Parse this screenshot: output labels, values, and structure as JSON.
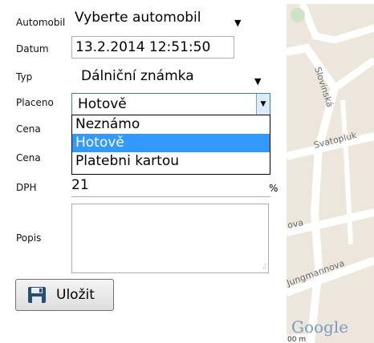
{
  "form": {
    "automobil": {
      "label": "Automobil",
      "value": "Vyberte automobil"
    },
    "datum": {
      "label": "Datum",
      "value": "13.2.2014 12:51:50"
    },
    "typ": {
      "label": "Typ",
      "value": "Dálniční známka"
    },
    "placeno": {
      "label": "Placeno",
      "value": "Hotově",
      "options": [
        "Neznámo",
        "Hotově",
        "Platebni kartou"
      ],
      "selected_index": 1
    },
    "cena1": {
      "label": "Cena"
    },
    "cena2": {
      "label": "Cena"
    },
    "dph": {
      "label": "DPH",
      "value": "21",
      "unit": "%"
    },
    "popis": {
      "label": "Popis",
      "value": ""
    },
    "save_button": {
      "label": "Uložit",
      "icon": "floppy-disk-icon"
    }
  },
  "map": {
    "streets": [
      "Slovinská",
      "Svatopluk",
      "ova",
      "Jungmannova"
    ],
    "logo": "Google",
    "scale_label": "00 m"
  },
  "colors": {
    "selection": "#3399ff",
    "dropdown_button": "#dcebfa",
    "map_background": "#ece6dc"
  }
}
